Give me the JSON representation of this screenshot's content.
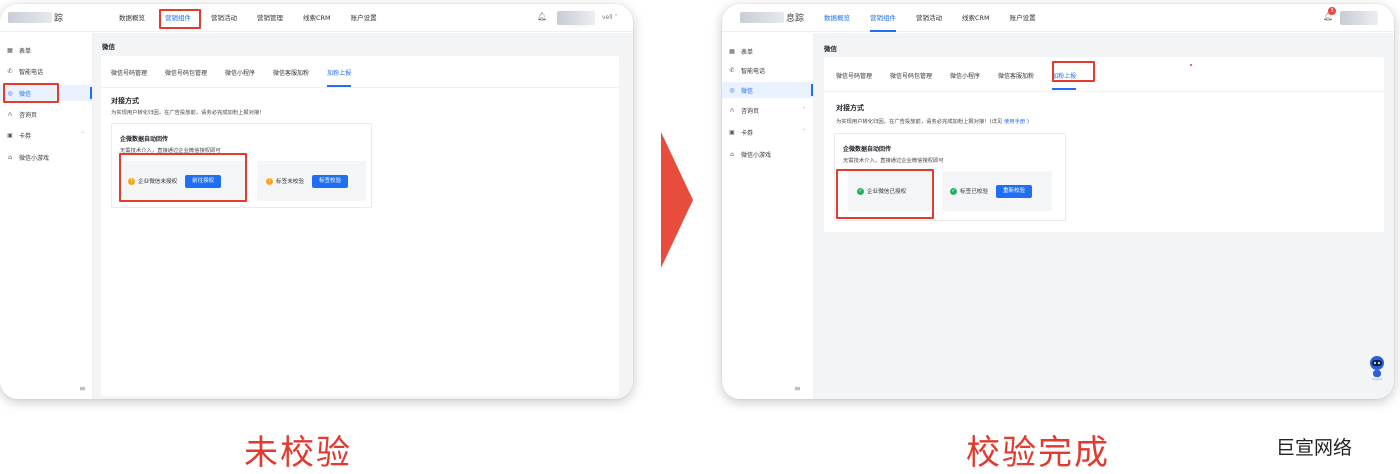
{
  "before": {
    "app_title_suffix": "踪",
    "nav_tabs": [
      "数据概览",
      "营销组件",
      "营销活动",
      "营销管理",
      "线索CRM",
      "账户设置"
    ],
    "active_nav": "营销组件",
    "username_fragment": "vell",
    "sidebar_items": [
      {
        "label": "表单",
        "icon": "grid-icon"
      },
      {
        "label": "智能电话",
        "icon": "phone-icon"
      },
      {
        "label": "微信",
        "icon": "wechat-icon",
        "active": true
      },
      {
        "label": "咨询页",
        "icon": "headset-icon"
      },
      {
        "label": "卡券",
        "icon": "coupon-icon",
        "chevron": true
      },
      {
        "label": "微信小游戏",
        "icon": "gamepad-icon"
      }
    ],
    "page_title": "微信",
    "sub_tabs": [
      "微信号码管理",
      "微信号码包管理",
      "微信小程序",
      "微信客服加粉",
      "加粉上报"
    ],
    "active_sub_tab": "加粉上报",
    "section_title": "对接方式",
    "section_desc": "为实现用户转化归因，在广告投放前，请务必完成加粉上报对接！",
    "box_title": "企微数据自动回传",
    "box_desc": "无需技术介入，直接通过企业微信授权即可",
    "status_a": {
      "label": "企业微信未授权",
      "button": "前往授权",
      "state": "warn"
    },
    "status_b": {
      "label": "标签未校验",
      "button": "标签校验",
      "state": "warn"
    },
    "collapse_icon": "≡"
  },
  "after": {
    "app_title_suffix": "息踪",
    "nav_tabs": [
      "数据概览",
      "营销组件",
      "营销活动",
      "线索CRM",
      "账户设置"
    ],
    "active_nav": "营销组件",
    "notification_count": "3",
    "sidebar_items": [
      {
        "label": "表单",
        "icon": "grid-icon"
      },
      {
        "label": "智能电话",
        "icon": "phone-icon"
      },
      {
        "label": "微信",
        "icon": "wechat-icon",
        "active": true
      },
      {
        "label": "咨询页",
        "icon": "headset-icon",
        "chevron": true
      },
      {
        "label": "卡券",
        "icon": "coupon-icon",
        "chevron": true
      },
      {
        "label": "微信小游戏",
        "icon": "gamepad-icon"
      }
    ],
    "page_title": "微信",
    "sub_tabs": [
      "微信号码管理",
      "微信号码包管理",
      "微信小程序",
      "微信客服加粉",
      "加粉上报"
    ],
    "active_sub_tab": "加粉上报",
    "section_title": "对接方式",
    "section_desc": "为实现用户转化归因，在广告投放前，请务必完成加粉上报对接！(详见",
    "section_link": "使用手册",
    "section_desc_end": ")",
    "box_title": "企微数据自动回传",
    "box_desc": "无需技术介入，直接通过企业微信授权即可",
    "status_a": {
      "label": "企业微信已授权",
      "state": "ok"
    },
    "status_b": {
      "label": "标签已校验",
      "button": "重新校验",
      "state": "ok"
    },
    "collapse_icon": "≡"
  },
  "captions": {
    "before": "未校验",
    "after": "校验完成"
  },
  "watermark": "巨宣网络",
  "colors": {
    "accent": "#1f6ff5",
    "highlight": "#e43b2f",
    "warn": "#f5a623",
    "ok": "#27ae60",
    "arrow": "#e74c3c"
  }
}
